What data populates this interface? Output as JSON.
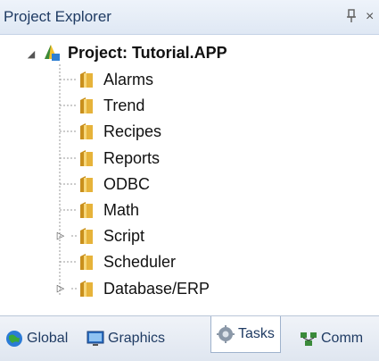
{
  "panel": {
    "title": "Project Explorer",
    "pin_glyph": "p̲",
    "close_glyph": "×"
  },
  "tree": {
    "root": {
      "label": "Project: Tutorial.APP",
      "expander": "◢",
      "icon": "project-icon"
    },
    "items": [
      {
        "label": "Alarms",
        "expandable": false
      },
      {
        "label": "Trend",
        "expandable": false
      },
      {
        "label": "Recipes",
        "expandable": false
      },
      {
        "label": "Reports",
        "expandable": false
      },
      {
        "label": "ODBC",
        "expandable": false
      },
      {
        "label": "Math",
        "expandable": false
      },
      {
        "label": "Script",
        "expandable": true,
        "expander": "▷"
      },
      {
        "label": "Scheduler",
        "expandable": false
      },
      {
        "label": "Database/ERP",
        "expandable": true,
        "expander": "▷"
      }
    ]
  },
  "tabs": [
    {
      "label": "Global",
      "icon": "globe-icon",
      "active": false
    },
    {
      "label": "Graphics",
      "icon": "graphics-icon",
      "active": false
    },
    {
      "label": "Tasks",
      "icon": "tasks-icon",
      "active": true
    },
    {
      "label": "Comm",
      "icon": "comm-icon",
      "active": false
    }
  ],
  "colors": {
    "folder": "#e7b33a",
    "accent": "#1f3b63"
  }
}
